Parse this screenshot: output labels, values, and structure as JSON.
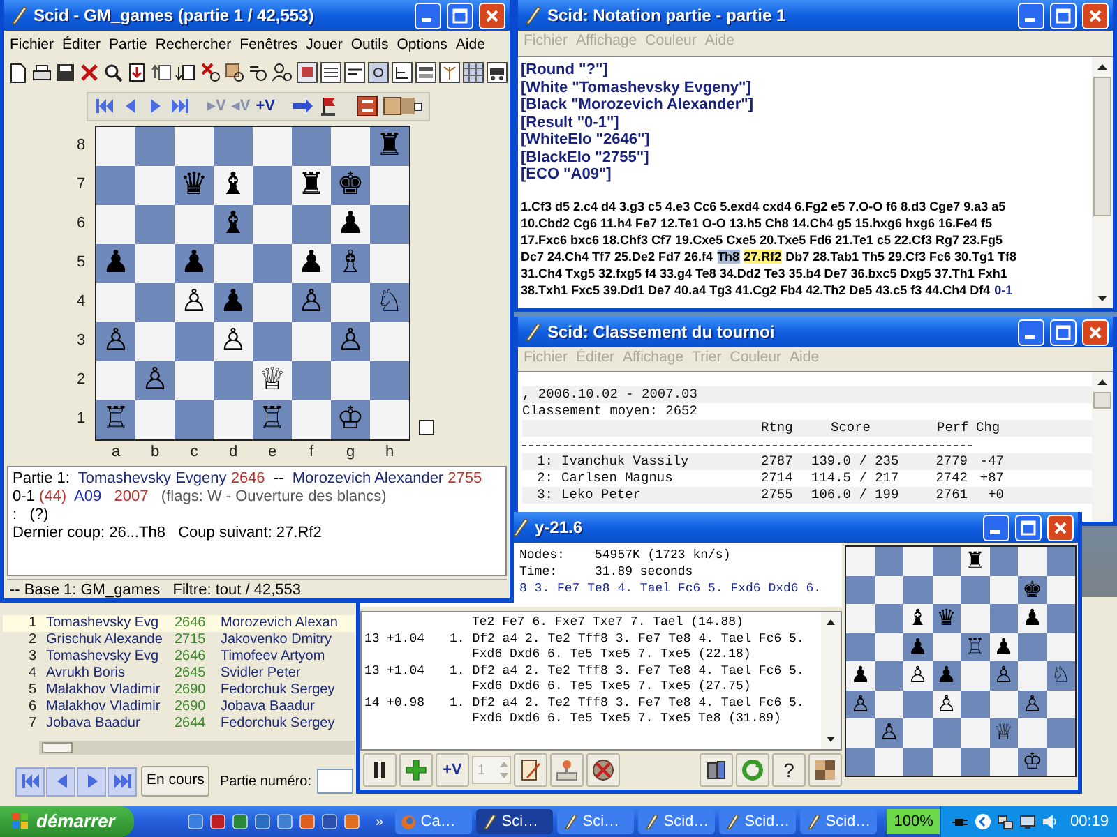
{
  "main_window": {
    "title": "Scid - GM_games (partie 1 / 42,553)",
    "menu": [
      {
        "label": "Fichier",
        "disabled": false
      },
      {
        "label": "Éditer",
        "disabled": false
      },
      {
        "label": "Partie",
        "disabled": false
      },
      {
        "label": "Rechercher",
        "disabled": false
      },
      {
        "label": "Fenêtres",
        "disabled": false
      },
      {
        "label": "Jouer",
        "disabled": false
      },
      {
        "label": "Outils",
        "disabled": false
      },
      {
        "label": "Options",
        "disabled": false
      },
      {
        "label": "Aide",
        "disabled": false
      }
    ],
    "variation_buttons": [
      {
        "label": "▸V",
        "disabled": true
      },
      {
        "label": "◂V",
        "disabled": true
      },
      {
        "label": "+V",
        "disabled": false
      }
    ],
    "board": {
      "ranks": [
        "8",
        "7",
        "6",
        "5",
        "4",
        "3",
        "2",
        "1"
      ],
      "files": [
        "a",
        "b",
        "c",
        "d",
        "e",
        "f",
        "g",
        "h"
      ],
      "white_to_move": true,
      "rows": [
        [
          null,
          null,
          null,
          null,
          null,
          null,
          null,
          "♜"
        ],
        [
          null,
          null,
          "♛",
          "♝",
          null,
          "♜",
          "♚",
          null
        ],
        [
          null,
          null,
          null,
          "♝",
          null,
          null,
          "♟",
          null
        ],
        [
          "♟",
          null,
          "♟",
          null,
          null,
          "♟",
          "♗",
          null
        ],
        [
          null,
          null,
          "♙",
          "♟",
          null,
          "♙",
          null,
          "♘"
        ],
        [
          "♙",
          null,
          null,
          "♙",
          null,
          null,
          "♙",
          null
        ],
        [
          null,
          "♙",
          null,
          null,
          "♕",
          null,
          null,
          null
        ],
        [
          "♖",
          null,
          null,
          null,
          "♖",
          null,
          "♔",
          null
        ]
      ]
    },
    "game_info": [
      [
        {
          "kind": "label",
          "text": "Partie 1:  "
        },
        {
          "kind": "player",
          "text": "Tomashevsky Evgeny "
        },
        {
          "kind": "elo",
          "text": "2646"
        },
        {
          "kind": "label",
          "text": "  --  "
        },
        {
          "kind": "player",
          "text": "Morozevich Alexander "
        },
        {
          "kind": "elo",
          "text": "2755"
        }
      ],
      [
        {
          "kind": "label",
          "text": "0-1 "
        },
        {
          "kind": "elo",
          "text": "(44)"
        },
        {
          "kind": "eco",
          "text": "  A09  "
        },
        {
          "kind": "elo",
          "text": " 2007"
        },
        {
          "kind": "flags",
          "text": "   (flags: W - Ouverture des blancs)"
        }
      ],
      [
        {
          "kind": "label",
          "text": ":   (?)"
        }
      ],
      [
        {
          "kind": "label",
          "text": "Dernier coup: 26...Th8   Coup suivant: 27.Rf2"
        }
      ]
    ],
    "status_bar": "-- Base 1: GM_games   Filtre: tout / 42,553"
  },
  "game_list": {
    "rows": [
      {
        "number": "1",
        "white": "Tomashevsky Evg",
        "white_elo": "2646",
        "black": "Morozevich Alexan",
        "selected": true
      },
      {
        "number": "2",
        "white": "Grischuk Alexande",
        "white_elo": "2715",
        "black": "Jakovenko Dmitry",
        "selected": false
      },
      {
        "number": "3",
        "white": "Tomashevsky Evg",
        "white_elo": "2646",
        "black": "Timofeev Artyom",
        "selected": false
      },
      {
        "number": "4",
        "white": "Avrukh Boris",
        "white_elo": "2645",
        "black": "Svidler Peter",
        "selected": false
      },
      {
        "number": "5",
        "white": "Malakhov Vladimir",
        "white_elo": "2690",
        "black": "Fedorchuk Sergey",
        "selected": false
      },
      {
        "number": "6",
        "white": "Malakhov Vladimir",
        "white_elo": "2690",
        "black": "Jobava Baadur",
        "selected": false
      },
      {
        "number": "7",
        "white": "Jobava Baadur",
        "white_elo": "2644",
        "black": "Fedorchuk Sergey",
        "selected": false
      }
    ],
    "current_button": "En cours",
    "game_number_label": "Partie numéro:"
  },
  "notation_window": {
    "title": "Scid: Notation partie - partie 1",
    "menu": [
      {
        "label": "Fichier",
        "disabled": true
      },
      {
        "label": "Affichage",
        "disabled": true
      },
      {
        "label": "Couleur",
        "disabled": true
      },
      {
        "label": "Aide",
        "disabled": true
      }
    ],
    "headers": [
      "[Round \"?\"]",
      "[White \"Tomashevsky Evgeny\"]",
      "[Black \"Morozevich Alexander\"]",
      "[Result \"0-1\"]",
      "[WhiteElo \"2646\"]",
      "[BlackElo \"2755\"]",
      "[ECO \"A09\"]"
    ],
    "moves": [
      [
        {
          "kind": "move",
          "text": "1.Cf3 d5 2.c4 d4 3.g3 c5 4.e3 Cc6 5.exd4 cxd4 6.Fg2 e5 7.O-O f6 8.d3 Cge7 9.a3 a5"
        }
      ],
      [
        {
          "kind": "move",
          "text": "10.Cbd2 Cg6 11.h4 Fe7 12.Te1 O-O 13.h5 Ch8 14.Ch4 g5 15.hxg6 hxg6 16.Fe4 f5"
        }
      ],
      [
        {
          "kind": "move",
          "text": "17.Fxc6 bxc6 18.Chf3 Cf7 19.Cxe5 Cxe5 20.Txe5 Fd6 21.Te1 c5 22.Cf3 Rg7 23.Fg5"
        }
      ],
      [
        {
          "kind": "move",
          "text": "Dc7 24.Ch4 Tf7 25.De2 Fd7 26.f4"
        },
        {
          "kind": "current",
          "text": "Th8"
        },
        {
          "kind": "next",
          "text": "27.Rf2"
        },
        {
          "kind": "move",
          "text": "Db7 28.Tab1 Th5 29.Cf3 Fc6 30.Tg1 Tf8"
        }
      ],
      [
        {
          "kind": "move",
          "text": "31.Ch4 Txg5 32.fxg5 f4 33.g4 Te8 34.Dd2 Te3 35.b4 De7 36.bxc5 Dxg5 37.Th1 Fxh1"
        }
      ],
      [
        {
          "kind": "move",
          "text": "38.Txh1 Fxc5 39.Dd1 De7 40.a4 Tg3 41.Cg2 Fb4 42.Th2 De5 43.c5 f3 44.Ch4 Df4"
        },
        {
          "kind": "result",
          "text": "0-1"
        }
      ]
    ]
  },
  "tournament_window": {
    "title": "Scid: Classement du tournoi",
    "menu": [
      {
        "label": "Fichier",
        "disabled": true
      },
      {
        "label": "Éditer",
        "disabled": true
      },
      {
        "label": "Affichage",
        "disabled": true
      },
      {
        "label": "Trier",
        "disabled": true
      },
      {
        "label": "Couleur",
        "disabled": true
      },
      {
        "label": "Aide",
        "disabled": true
      }
    ],
    "lines": [
      ", 2006.10.02 - 2007.03",
      "Classement moyen: 2652"
    ],
    "columns": [
      "Rtng",
      "Score",
      "Perf",
      "Chg"
    ],
    "rows": [
      {
        "rank": "1:",
        "name": "Ivanchuk Vassily",
        "rating": "2787",
        "score": "139.0 / 235",
        "perf": "2779",
        "change": "-47"
      },
      {
        "rank": "2:",
        "name": "Carlsen Magnus",
        "rating": "2714",
        "score": "114.5 / 217",
        "perf": "2742",
        "change": "+87"
      },
      {
        "rank": "3:",
        "name": "Leko Peter",
        "rating": "2755",
        "score": "106.0 / 199",
        "perf": "2761",
        "change": "+0"
      }
    ]
  },
  "engine_window": {
    "title": "y-21.6",
    "stats": [
      {
        "label": "Nodes:",
        "value": "54957K (1723 kn/s)"
      },
      {
        "label": "Time:",
        "value": "31.89 seconds"
      }
    ],
    "best_line": "8 3. Fe7 Te8 4. Tael Fc6 5. Fxd6 Dxd6 6.",
    "analysis": [
      {
        "kind": "continuation",
        "text": "Te2 Fe7 6. Fxe7 Txe7 7. Tael (14.88)"
      },
      {
        "kind": "head",
        "depth": "13",
        "score": "+1.04",
        "text": "1. Df2 a4 2. Te2 Tff8 3. Fe7 Te8 4. Tael Fc6 5."
      },
      {
        "kind": "continuation",
        "text": "Fxd6 Dxd6 6. Te5 Txe5 7. Txe5 (22.18)"
      },
      {
        "kind": "head",
        "depth": "13",
        "score": "+1.04",
        "text": "1. Df2 a4 2. Te2 Tff8 3. Fe7 Te8 4. Tael Fc6 5."
      },
      {
        "kind": "continuation",
        "text": "Fxd6 Dxd6 6. Te5 Txe5 7. Txe5 (27.75)"
      },
      {
        "kind": "head",
        "depth": "14",
        "score": "+0.98",
        "text": "1. Df2 a4 2. Te2 Tff8 3. Fe7 Te8 4. Tael Fc6 5."
      },
      {
        "kind": "continuation",
        "text": "Fxd6 Dxd6 6. Te5 Txe5 7. Txe5 Te8 (31.89)"
      }
    ],
    "add_variation": "+V",
    "multipv": {
      "value": "1",
      "disabled": true
    },
    "help": "?",
    "board": {
      "rows": [
        [
          null,
          null,
          null,
          null,
          "♜",
          null,
          null,
          null
        ],
        [
          null,
          null,
          null,
          null,
          null,
          null,
          "♚",
          null
        ],
        [
          null,
          null,
          "♝",
          "♛",
          null,
          null,
          "♟",
          null
        ],
        [
          null,
          null,
          "♟",
          null,
          "♖",
          "♟",
          null,
          null
        ],
        [
          "♟",
          null,
          "♙",
          "♟",
          null,
          "♙",
          null,
          "♘"
        ],
        [
          "♙",
          null,
          null,
          "♙",
          null,
          null,
          "♙",
          null
        ],
        [
          null,
          "♙",
          null,
          null,
          null,
          "♕",
          null,
          null
        ],
        [
          null,
          null,
          null,
          null,
          null,
          null,
          "♔",
          null
        ]
      ]
    }
  },
  "taskbar": {
    "start": "démarrer",
    "overflow": "»",
    "tasks": [
      {
        "kind": "browser",
        "label": "Ca…",
        "selected": false
      },
      {
        "kind": "scid",
        "label": "Sci…",
        "selected": true
      },
      {
        "kind": "scid",
        "label": "Sci…",
        "selected": false
      },
      {
        "kind": "scid",
        "label": "Scid…",
        "selected": false
      },
      {
        "kind": "scid",
        "label": "Scid…",
        "selected": false
      },
      {
        "kind": "scid",
        "label": "Scid…",
        "selected": false
      }
    ],
    "battery": "100%",
    "clock": "00:19"
  }
}
